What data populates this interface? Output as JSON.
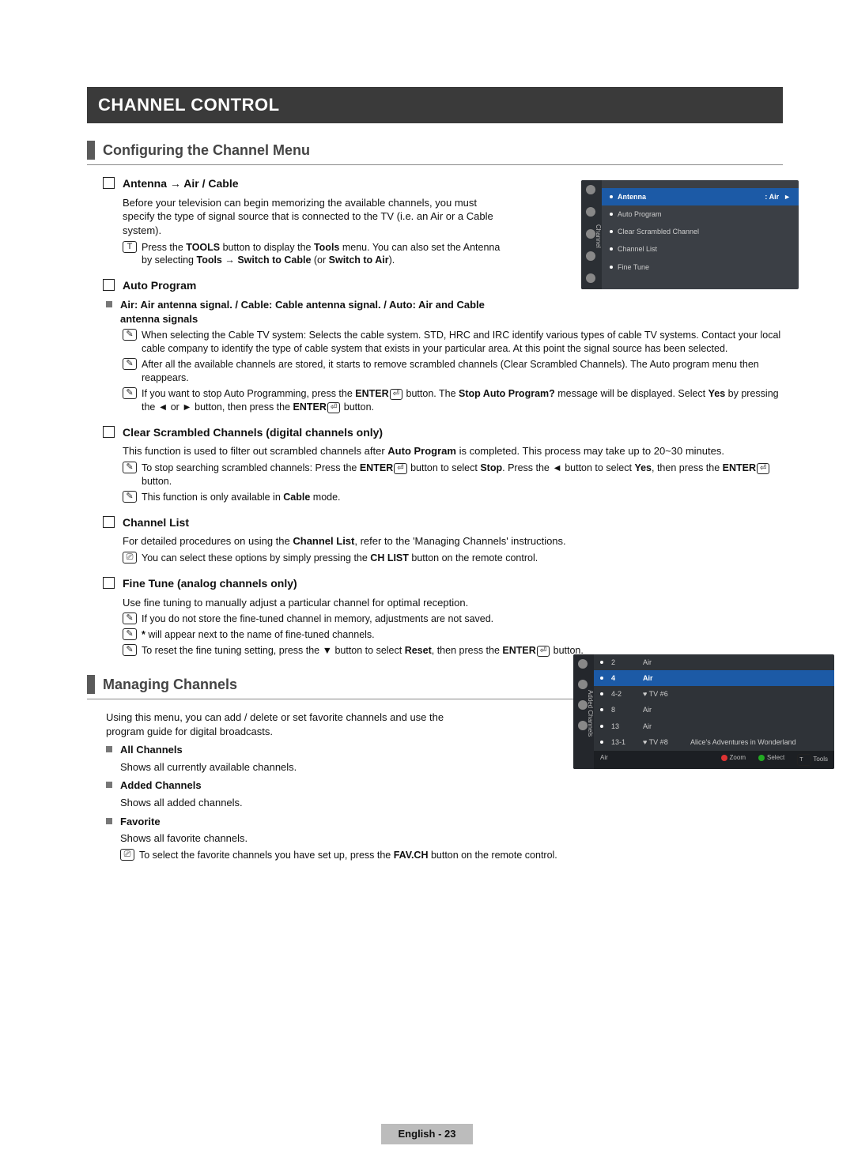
{
  "chapter": "CHANNEL CONTROL",
  "sec1": {
    "title": "Configuring the Channel Menu",
    "antenna": {
      "heading": "Antenna → Air / Cable",
      "body": "Before your television can begin memorizing the available channels, you must specify the type of signal source that is connected to the TV (i.e. an Air or a Cable system).",
      "tool_pre": "Press the ",
      "tool_bold1": "TOOLS",
      "tool_mid": " button to display the ",
      "tool_bold2": "Tools",
      "tool_mid2": " menu. You can also set the Antenna by selecting ",
      "tool_bold3": "Tools → Switch to Cable",
      "tool_mid3": " (or ",
      "tool_bold4": "Switch to Air",
      "tool_end": ")."
    },
    "auto": {
      "heading": "Auto Program",
      "sig": "Air: Air antenna signal. / Cable: Cable antenna signal. / Auto: Air and Cable antenna signals",
      "n1": "When selecting the Cable TV system: Selects the cable system. STD, HRC and IRC identify various types of cable TV systems. Contact your local cable company to identify the type of cable system that exists in your particular area. At this point the signal source has been selected.",
      "n2": "After all the available channels are stored, it starts to remove scrambled channels (Clear Scrambled Channels). The Auto program menu then reappears.",
      "n3_pre": "If you want to stop Auto Programming, press the ",
      "n3_enter": "ENTER",
      "n3_mid": " button. The ",
      "n3_bold": "Stop Auto Program?",
      "n3_mid2": " message will be displayed. Select ",
      "n3_yes": "Yes",
      "n3_mid3": " by pressing the ◄ or ► button, then press the ",
      "n3_end": " button."
    },
    "clear": {
      "heading": "Clear Scrambled Channels (digital channels only)",
      "body_pre": "This function is used to filter out scrambled channels after ",
      "body_bold": "Auto Program",
      "body_post": " is completed. This process may take up to 20~30 minutes.",
      "n1_pre": "To stop searching scrambled channels: Press the ",
      "n1_mid": " button to select ",
      "n1_stop": "Stop",
      "n1_mid2": ". Press the ◄ button to select ",
      "n1_yes": "Yes",
      "n1_mid3": ", then press the ",
      "n1_end": " button.",
      "n2_pre": "This function is only available in ",
      "n2_bold": "Cable",
      "n2_post": " mode."
    },
    "chlist": {
      "heading": "Channel List",
      "body_pre": "For detailed procedures on using the ",
      "body_bold": "Channel List",
      "body_post": ", refer to the 'Managing Channels' instructions.",
      "n1_pre": "You can select these options by simply pressing the ",
      "n1_bold": "CH LIST",
      "n1_post": " button on the remote control."
    },
    "fine": {
      "heading": "Fine Tune (analog channels only)",
      "body": "Use fine tuning to manually adjust a particular channel for optimal reception.",
      "n1": "If you do not store the fine-tuned channel in memory, adjustments are not saved.",
      "n2_pre": "",
      "n2_bold": "*",
      "n2_post": " will appear next to the name of fine-tuned channels.",
      "n3_pre": "To reset the fine tuning setting, press the ▼ button to select ",
      "n3_bold": "Reset",
      "n3_mid": ", then press the ",
      "n3_end": " button."
    }
  },
  "sec2": {
    "title": "Managing Channels",
    "body": "Using this menu, you can add / delete or set favorite channels and use the program guide for digital broadcasts.",
    "all_h": "All Channels",
    "all_b": "Shows all currently available channels.",
    "added_h": "Added Channels",
    "added_b": "Shows all added channels.",
    "fav_h": "Favorite",
    "fav_b": "Shows all favorite channels.",
    "fav_note_pre": "To select the favorite channels you have set up, press the ",
    "fav_note_bold": "FAV.CH",
    "fav_note_post": " button on the remote control."
  },
  "osd1": {
    "side": "Channel",
    "rows": [
      {
        "label": "Antenna",
        "value": ": Air",
        "sel": true,
        "arrow": "►"
      },
      {
        "label": "Auto Program"
      },
      {
        "label": "Clear Scrambled Channel"
      },
      {
        "label": "Channel List"
      },
      {
        "label": "Fine Tune"
      }
    ]
  },
  "osd2": {
    "side": "Added Channels",
    "rows": [
      {
        "num": "2",
        "tv": "Air"
      },
      {
        "num": "4",
        "tv": "Air",
        "sel": true
      },
      {
        "num": "4-2",
        "tv": "♥ TV #6"
      },
      {
        "num": "8",
        "tv": "Air"
      },
      {
        "num": "13",
        "tv": "Air"
      },
      {
        "num": "13-1",
        "tv": "♥ TV #8",
        "title": "Alice's Adventures in Wonderland"
      }
    ],
    "bar_left": "Air",
    "bar_zoom": "Zoom",
    "bar_select": "Select",
    "bar_tools": "Tools"
  },
  "footer": "English - 23",
  "labels": {
    "enter": "ENTER",
    "enter_glyph": "⏎"
  }
}
